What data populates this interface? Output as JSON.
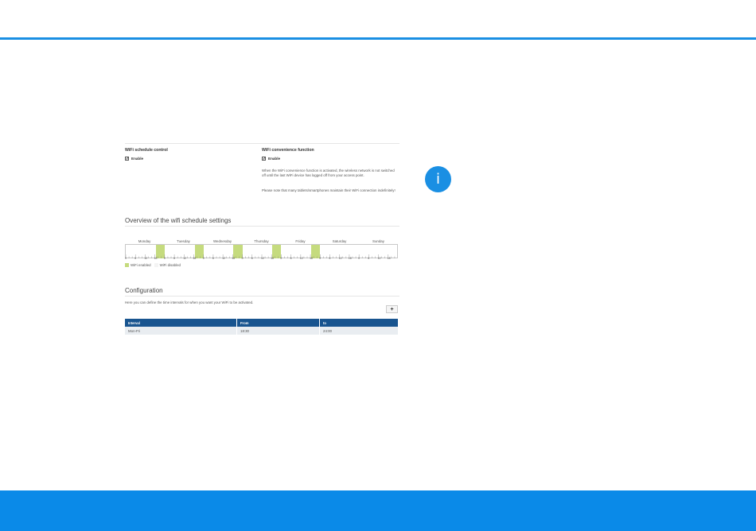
{
  "colors": {
    "accent": "#1a8fe3",
    "footer": "#0a8ae8",
    "enabled": "#c5db7e",
    "disabled": "#f4f4f4",
    "table_header": "#18548f"
  },
  "info_icon": {
    "icon": "info-icon",
    "glyph": "i"
  },
  "schedule_control": {
    "title": "WiFi schedule control",
    "enable_label": "Enable",
    "checked": true
  },
  "convenience": {
    "title": "WiFi convenience function",
    "enable_label": "Enable",
    "checked": true,
    "description": "When the WiFi convenience function is activated, the wireless network is not switched off until the last WiFi device has logged off from your access point.",
    "note": "Please note that many tablets/smartphones maintain their WiFi connection indefinitely!"
  },
  "overview": {
    "title": "Overview of the wifi schedule settings",
    "days": [
      "Monday",
      "Tuesday",
      "Wednesday",
      "Thursday",
      "Friday",
      "Saturday",
      "Sunday"
    ],
    "hour_labels": [
      "0",
      "6",
      "12",
      "18"
    ],
    "enabled_intervals": [
      {
        "day": 0,
        "from": 18.5,
        "to": 24
      },
      {
        "day": 1,
        "from": 18.5,
        "to": 24
      },
      {
        "day": 2,
        "from": 18.5,
        "to": 24
      },
      {
        "day": 3,
        "from": 18.5,
        "to": 24
      },
      {
        "day": 4,
        "from": 18.5,
        "to": 24
      }
    ],
    "legend": {
      "enabled": "WiFi enabled",
      "disabled": "WiFi disabled"
    }
  },
  "configuration": {
    "title": "Configuration",
    "description": "Here you can define the time intervals for when you want your WiFi to be activated.",
    "add_label": "+",
    "columns": [
      "Interval",
      "From",
      "to"
    ],
    "rows": [
      {
        "interval": "Mon-Fri",
        "from": "18:30",
        "to": "24:00"
      }
    ]
  }
}
